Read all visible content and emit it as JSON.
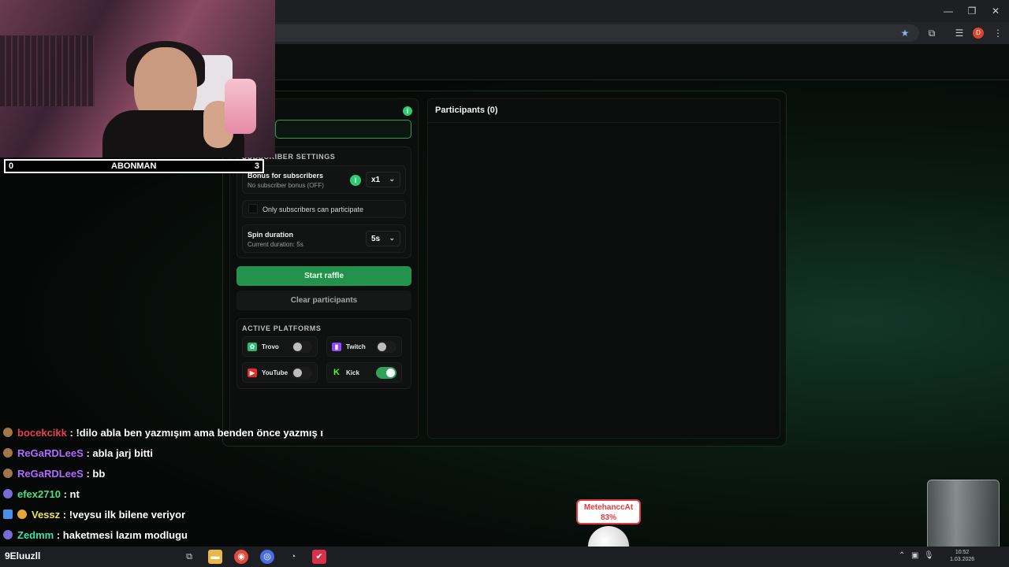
{
  "window": {
    "minimize": "—",
    "restore": "❐",
    "close": "✕"
  },
  "toolbar": {
    "bookmark_icon": "star-icon",
    "extensions_icon": "puzzle-icon",
    "media_icon": "media-icon",
    "profile_initial": "D",
    "menu_icon": "kebab-icon"
  },
  "goal": {
    "left": "0",
    "label": "ABONMAN",
    "right": "3"
  },
  "raffle": {
    "subscriber_settings_title": "SUBSCRIBER SETTINGS",
    "bonus_title": "Bonus for subscribers",
    "bonus_sub": "No subscriber bonus (OFF)",
    "bonus_value": "x1",
    "only_subs_label": "Only subscribers can participate",
    "spin_title": "Spin duration",
    "spin_sub": "Current duration: 5s",
    "spin_value": "5s",
    "start_label": "Start raffle",
    "clear_label": "Clear participants",
    "platforms_title": "ACTIVE PLATFORMS",
    "platforms": [
      {
        "name": "Trovo",
        "color": "#1fbf6b",
        "on": false
      },
      {
        "name": "Twitch",
        "color": "#9146ff",
        "on": false
      },
      {
        "name": "YouTube",
        "color": "#e52d27",
        "on": false
      },
      {
        "name": "Kick",
        "color": "#53fc18",
        "on": true
      }
    ],
    "participants_title": "Participants (0)"
  },
  "chat": [
    {
      "user": "bocekcikk",
      "color": "#e8414b",
      "msg": ": !dilo abla ben yazmışım ama benden önce yazmış ı"
    },
    {
      "user": "ReGaRDLeeS",
      "color": "#b06bff",
      "msg": ": abla jarj bitti"
    },
    {
      "user": "ReGaRDLeeS",
      "color": "#b06bff",
      "msg": ": bb"
    },
    {
      "user": "efex2710",
      "color": "#4ee07d",
      "msg": ": nt"
    },
    {
      "user": "Vessz",
      "color": "#f0e25a",
      "msg": ": !veysu ilk bilene veriyor"
    },
    {
      "user": "Zedmm",
      "color": "#3fe0a8",
      "msg": ": haketmesi lazım modlugu"
    }
  ],
  "winner": {
    "name": "MetehanccAt",
    "percent": "83%"
  },
  "taskbar": {
    "user": "9Eluuzll",
    "clock_time": "10:52",
    "clock_date": "1.03.2026"
  }
}
